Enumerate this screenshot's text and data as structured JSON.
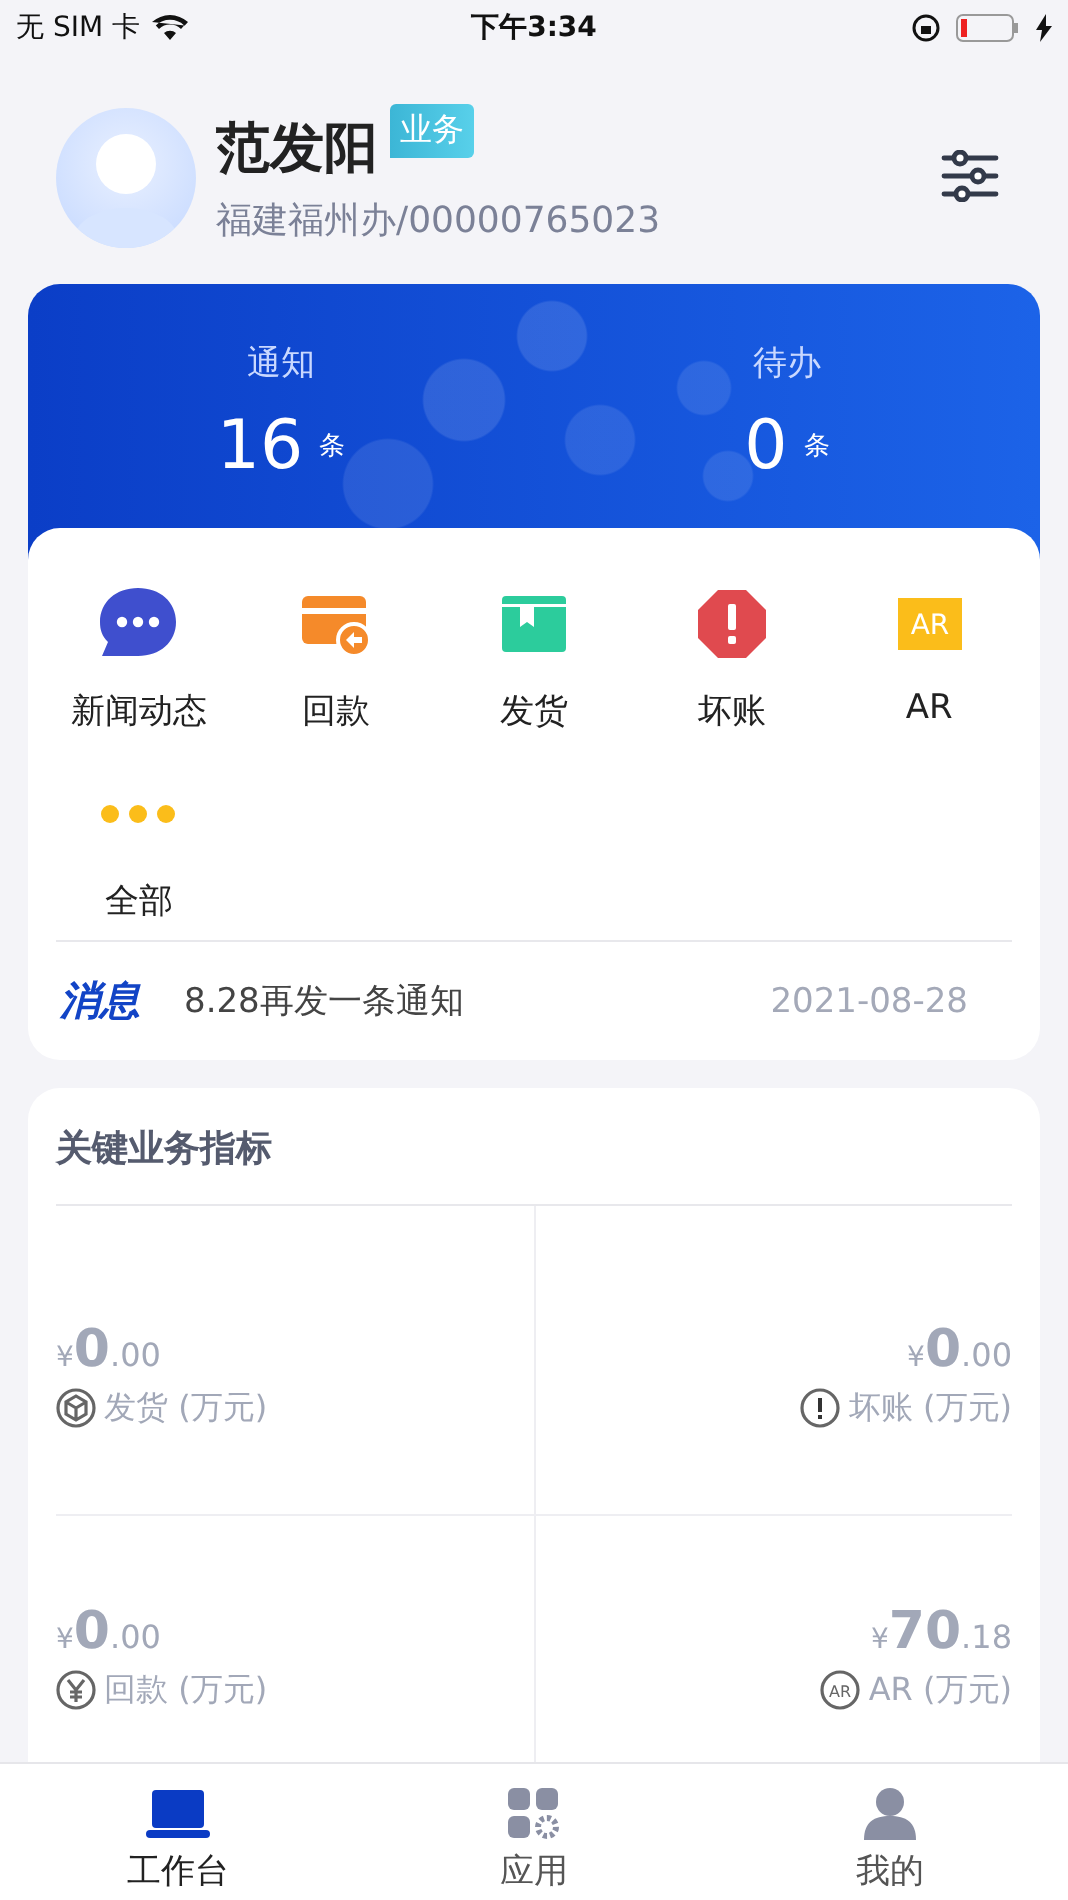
{
  "status_bar": {
    "carrier": "无 SIM 卡",
    "time": "下午3:34"
  },
  "profile": {
    "name": "范发阳",
    "tag": "业务",
    "subtitle": "福建福州办/00000765023"
  },
  "stats": [
    {
      "label": "通知",
      "value": "16",
      "unit": "条"
    },
    {
      "label": "待办",
      "value": "0",
      "unit": "条"
    }
  ],
  "shortcuts": [
    {
      "label": "新闻动态",
      "kind": "chat"
    },
    {
      "label": "回款",
      "kind": "card"
    },
    {
      "label": "发货",
      "kind": "box"
    },
    {
      "label": "坏账",
      "kind": "alert"
    },
    {
      "label": "AR",
      "kind": "ar",
      "icon_text": "AR"
    },
    {
      "label": "全部",
      "kind": "more"
    }
  ],
  "notice": {
    "badge": "消息",
    "text": "8.28再发一条通知",
    "date": "2021-08-28"
  },
  "metrics": {
    "title": "关键业务指标",
    "items": [
      {
        "currency": "¥",
        "integer": "0",
        "decimal": ".00",
        "label": "发货 (万元)",
        "kind": "box"
      },
      {
        "currency": "¥",
        "integer": "0",
        "decimal": ".00",
        "label": "坏账 (万元)",
        "kind": "alert"
      },
      {
        "currency": "¥",
        "integer": "0",
        "decimal": ".00",
        "label": "回款 (万元)",
        "kind": "yen"
      },
      {
        "currency": "¥",
        "integer": "70",
        "decimal": ".18",
        "label": "AR (万元)",
        "kind": "ar",
        "icon_text": "AR"
      }
    ]
  },
  "tabs": [
    {
      "label": "工作台",
      "kind": "laptop",
      "selected": true
    },
    {
      "label": "应用",
      "kind": "apps",
      "selected": false
    },
    {
      "label": "我的",
      "kind": "person",
      "selected": false
    }
  ]
}
